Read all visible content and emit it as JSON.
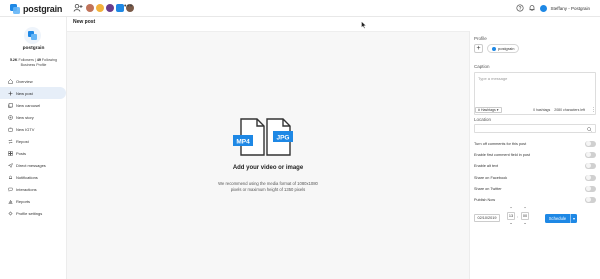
{
  "app": {
    "logo_text": "postgrain",
    "user_name": "Steffany - Postgrain",
    "more": "•••",
    "accent_color": "#1e88e5"
  },
  "sidebar": {
    "profile_name": "postgrain",
    "stats_followers": "5.2K",
    "stats_followers_label": "Followers",
    "stats_following": "49",
    "stats_following_label": "Following",
    "profile_type": "Business Profile",
    "items": [
      {
        "label": "Overview",
        "icon": "overview-icon"
      },
      {
        "label": "New post",
        "icon": "plus-icon"
      },
      {
        "label": "New carousel",
        "icon": "carousel-icon"
      },
      {
        "label": "New story",
        "icon": "story-icon"
      },
      {
        "label": "New IGTV",
        "icon": "igtv-icon"
      },
      {
        "label": "Repost",
        "icon": "repost-icon"
      },
      {
        "label": "Posts",
        "icon": "posts-icon"
      },
      {
        "label": "Direct messages",
        "icon": "messages-icon"
      },
      {
        "label": "Notifications",
        "icon": "bell-icon"
      },
      {
        "label": "Interactions",
        "icon": "interactions-icon"
      },
      {
        "label": "Reports",
        "icon": "reports-icon"
      },
      {
        "label": "Profile settings",
        "icon": "gear-icon"
      }
    ]
  },
  "main": {
    "title": "New post",
    "upload_title": "Add your video or image",
    "upload_desc": "We recommend using the media format of 1080x1080 pixels or maximum height of 1350 pixels",
    "file_labels": [
      "MP4",
      "JPG"
    ]
  },
  "right": {
    "profile_label": "Profile",
    "profile_chip": "postgrain",
    "caption_label": "Caption",
    "caption_placeholder": "Type a message",
    "hashtags_btn": "Hashtags",
    "hashtag_count": "0 hashtags",
    "chars_left": "2080 characters left",
    "location_label": "Location",
    "toggles": [
      "Turn off comments for this post",
      "Enable first comment field in post",
      "Enable alt text",
      "Share on Facebook",
      "Share on Twitter",
      "Publish Now"
    ],
    "date": "02/10/2019",
    "hour": "13",
    "minute": "00",
    "schedule_label": "Schedule"
  }
}
